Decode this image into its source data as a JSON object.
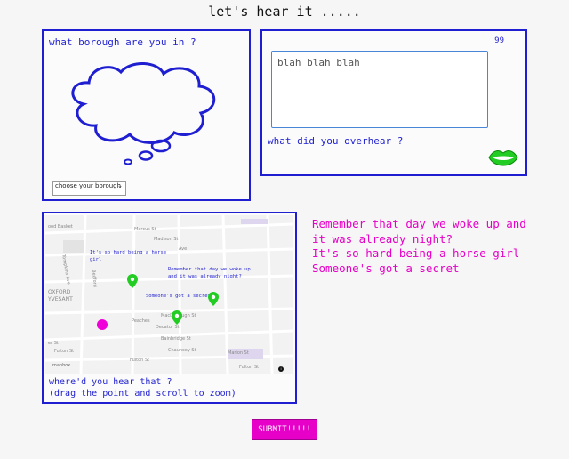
{
  "header": {
    "title": "let's hear it ....."
  },
  "borough": {
    "label": "what borough are you in ?",
    "select_value": "choose your borough"
  },
  "speech": {
    "char_count": "99",
    "input_value": "blah blah blah",
    "label": "what did you overhear ?"
  },
  "map": {
    "streets": [
      "ood Basket",
      "Marcus St",
      "Madison St",
      "Ave",
      "Tompkins Ave",
      "Bedford",
      "OXFORD",
      "YVESANT",
      "Peaches",
      "MacDonough St",
      "Decatur St",
      "Bainbridge St",
      "Chauncey St",
      "Marion St",
      "Fulton St",
      "Fulton St",
      "Fulton St",
      "er St"
    ],
    "notes": [
      "It's so hard being a horse girl",
      "Remember that day we woke up and it was already night?",
      "Someone's got a secret"
    ],
    "logo": "mapbox",
    "info": "i",
    "instruction_line1": "where'd you hear that ?",
    "instruction_line2": "(drag the point and scroll to zoom)"
  },
  "overheard": [
    "Remember that day we woke up and it was already night?",
    "It's so hard being a horse girl",
    "Someone's got a secret"
  ],
  "submit": {
    "label": "SUBMIT!!!!!"
  },
  "colors": {
    "accent_blue": "#1f1fd1",
    "magenta": "#e600c8",
    "pin_green": "#22cc22"
  }
}
